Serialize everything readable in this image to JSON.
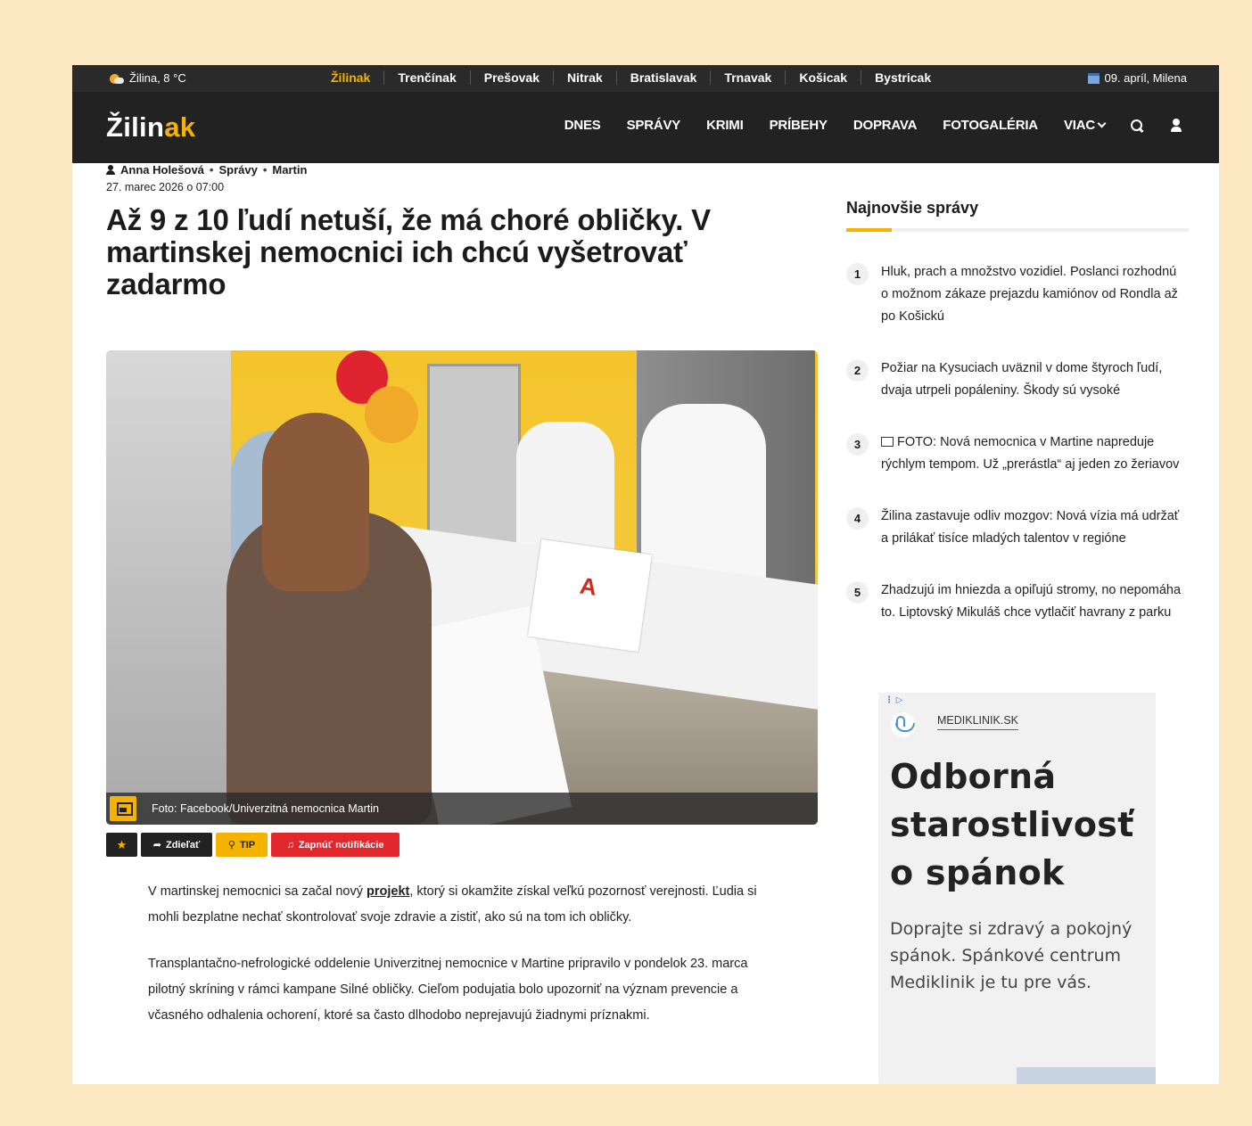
{
  "topbar": {
    "weather": "Žilina, 8 °C",
    "regions": [
      "Žilinak",
      "Trenčínak",
      "Prešovak",
      "Nitrak",
      "Bratislavak",
      "Trnavak",
      "Košicak",
      "Bystricak"
    ],
    "date": "09. apríl, Milena"
  },
  "header": {
    "logo_main": "Žilin",
    "logo_accent": "ak",
    "nav": [
      "DNES",
      "SPRÁVY",
      "KRIMI",
      "PRÍBEHY",
      "DOPRAVA",
      "FOTOGALÉRIA"
    ],
    "more": "VIAC"
  },
  "article": {
    "author": "Anna Holešová",
    "category": "Správy",
    "location": "Martin",
    "date": "27. marec 2026 o 07:00",
    "title": "Až 9 z 10 ľudí netuší, že má choré obličky. V martinskej nemocnici ich chcú vyšetrovať zadarmo",
    "photo_caption": "Foto: Facebook/Univerzitná nemocnica Martin",
    "actions": {
      "share": "Zdieľať",
      "tip": "TIP",
      "notifications": "Zapnúť notifikácie"
    },
    "p1_before": "V martinskej nemocnici sa začal nový ",
    "p1_link": "projekt",
    "p1_after": ", ktorý si okamžite získal veľkú pozornosť verejnosti. Ľudia si mohli bezplatne nechať skontrolovať svoje zdravie a zistiť, ako sú na tom ich obličky.",
    "p2": "Transplantačno-nefrologické oddelenie Univerzitnej nemocnice v Martine pripravilo v pondelok 23. marca pilotný skríning v rámci kampane Silné obličky. Cieľom podujatia bolo upozorniť na význam prevencie a včasného odhalenia ochorení, ktoré sa často dlhodobo neprejavujú žiadnymi príznakmi."
  },
  "sidebar": {
    "title": "Najnovšie správy",
    "items": [
      {
        "num": "1",
        "text": "Hluk, prach a množstvo vozidiel. Poslanci rozhodnú o možnom zákaze prejazdu kamiónov od Rondla až po Košickú"
      },
      {
        "num": "2",
        "text": "Požiar na Kysuciach uväznil v dome štyroch ľudí, dvaja utrpeli popáleniny. Škody sú vysoké"
      },
      {
        "num": "3",
        "text": "FOTO: Nová nemocnica v Martine napreduje rýchlym tempom. Už „prerástla“ aj jeden zo žeriavov"
      },
      {
        "num": "4",
        "text": "Žilina zastavuje odliv mozgov: Nová vízia má udržať a prilákať tisíce mladých talentov v regióne"
      },
      {
        "num": "5",
        "text": "Zhadzujú im hniezda a opiľujú stromy, no nepomáha to. Liptovský Mikuláš chce vytlačiť havrany z parku"
      }
    ]
  },
  "ad": {
    "brand": "MEDIKLINIK.SK",
    "headline": "Odborná starostlivosť o spánok",
    "description": "Doprajte si zdravý a pokojný spánok. Spánkové centrum Mediklinik je tu pre vás."
  },
  "colors": {
    "accent": "#f5b300",
    "notif_red": "#e1262c",
    "header_dark": "#222222",
    "page_bg": "#fbe7c1"
  },
  "icons": [
    "weather-sun-cloud-icon",
    "calendar-icon",
    "chevron-down-icon",
    "search-icon",
    "user-icon",
    "author-icon",
    "image-icon",
    "star-icon",
    "share-icon",
    "bulb-icon",
    "bell-icon",
    "adchoices-icon",
    "swan-logo-icon"
  ]
}
